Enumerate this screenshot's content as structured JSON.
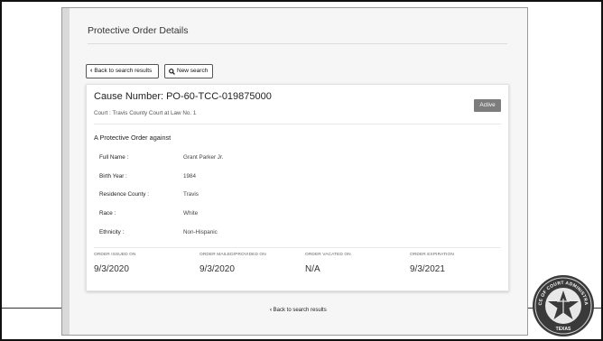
{
  "page": {
    "title": "Protective Order Details",
    "back_button_label": "Back to search results",
    "new_search_label": "New search"
  },
  "card": {
    "cause_number": "Cause Number: PO-60-TCC-019875000",
    "court": "Court : Travis County Court at Law No. 1",
    "status_badge": "Active",
    "subheading": "A Protective Order against"
  },
  "details": [
    {
      "label": "Full Name :",
      "value": "Grant Parker Jr."
    },
    {
      "label": "Birth Year :",
      "value": "1984"
    },
    {
      "label": "Residence County :",
      "value": "Travis"
    },
    {
      "label": "Race :",
      "value": "White"
    },
    {
      "label": "Ethnicity :",
      "value": "Non-Hispanic"
    }
  ],
  "dates": [
    {
      "label": "ORDER ISSUED ON",
      "value": "9/3/2020"
    },
    {
      "label": "ORDER MAILED/PROVIDED ON",
      "value": "9/3/2020"
    },
    {
      "label": "ORDER VACATED ON",
      "value": "N/A"
    },
    {
      "label": "ORDER EXPIRATION",
      "value": "9/3/2021"
    }
  ],
  "footer": {
    "back_link_label": "Back to search results"
  },
  "seal": {
    "text_top": "OFFICE OF COURT ADMINISTRATION",
    "text_bottom": "TEXAS"
  },
  "colors": {
    "badge_bg": "#7d7d7d",
    "page_bg": "#f6f6f6",
    "card_bg": "#ffffff"
  }
}
